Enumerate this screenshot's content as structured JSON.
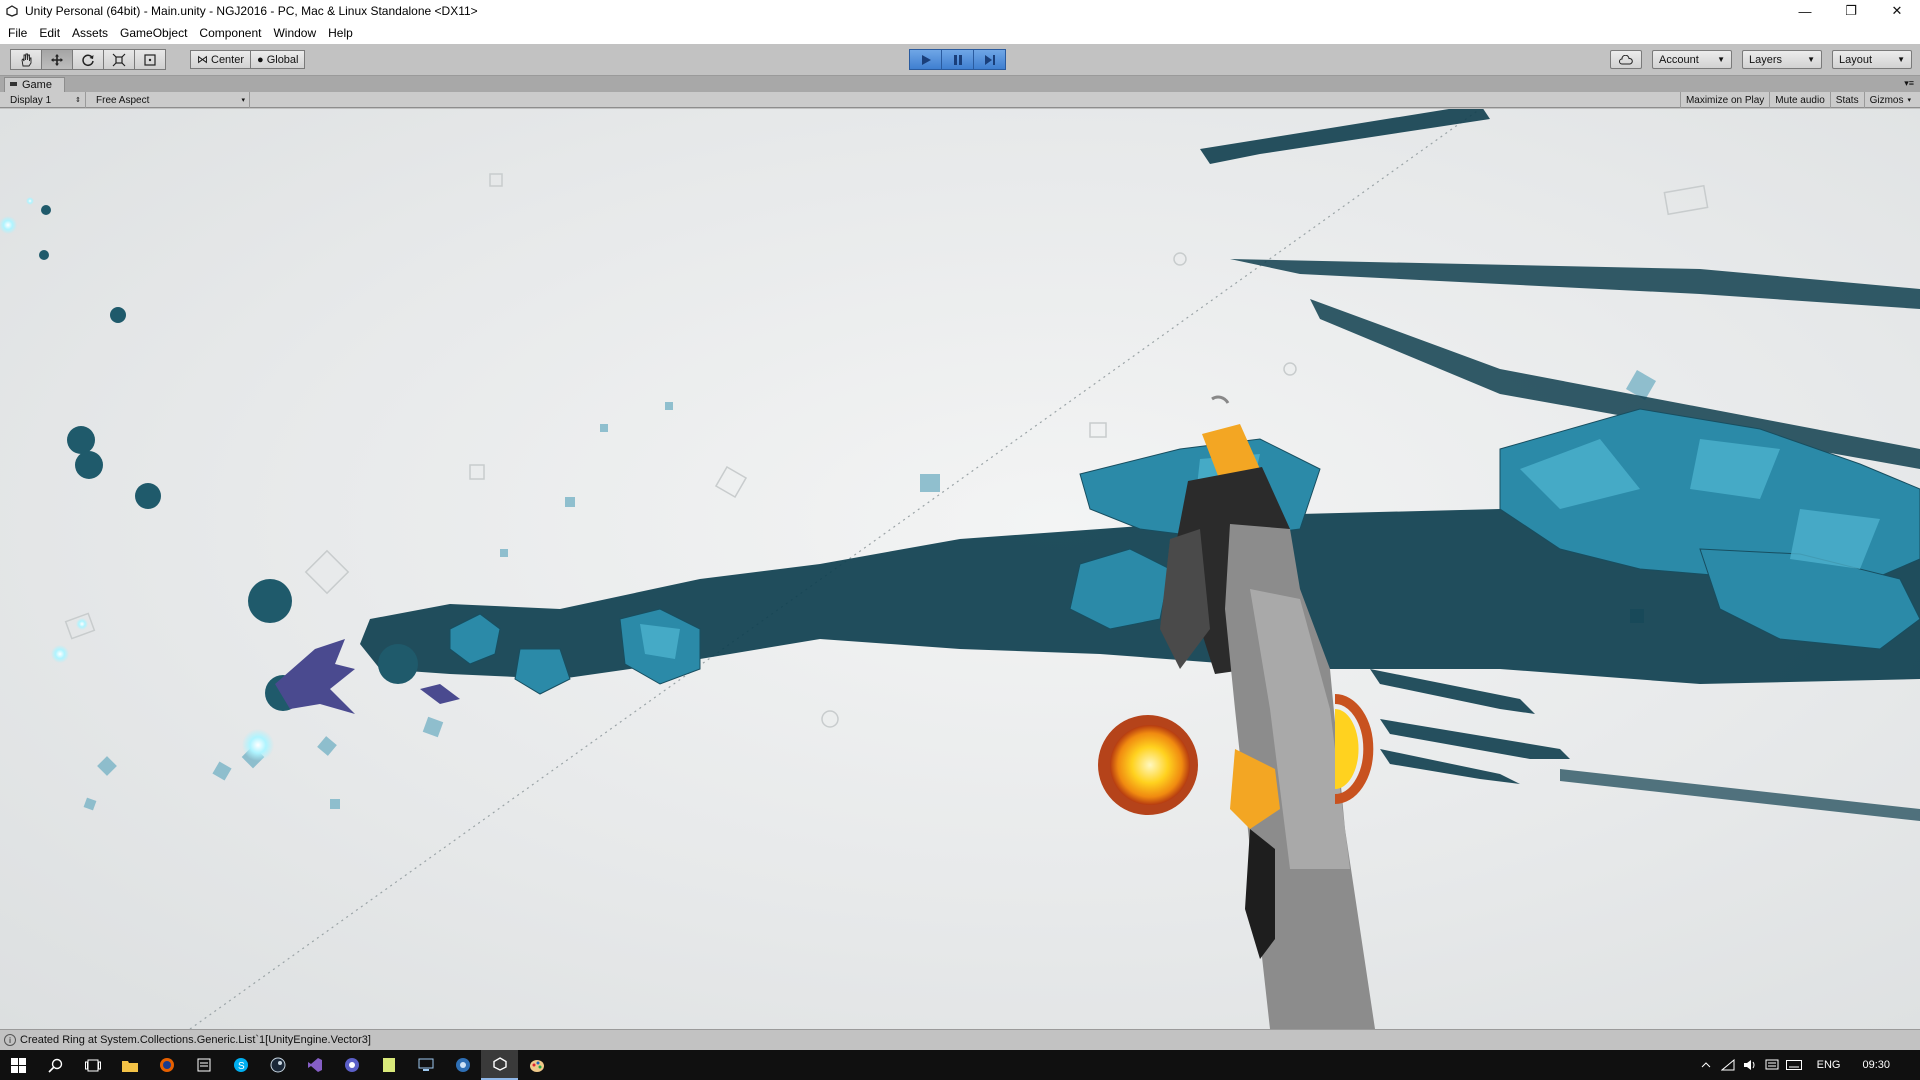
{
  "window": {
    "title": "Unity Personal (64bit) - Main.unity - NGJ2016 - PC, Mac & Linux Standalone <DX11>",
    "minimize": "—",
    "restore": "❐",
    "close": "✕"
  },
  "menu": {
    "items": [
      "File",
      "Edit",
      "Assets",
      "GameObject",
      "Component",
      "Window",
      "Help"
    ]
  },
  "toolbar": {
    "transform_tools": [
      "hand-icon",
      "move-icon",
      "rotate-icon",
      "scale-icon",
      "rect-tool-icon"
    ],
    "pivot_label": "Center",
    "space_label": "Global",
    "play_controls": [
      "play-icon",
      "pause-icon",
      "step-icon"
    ],
    "account_label": "Account",
    "layers_label": "Layers",
    "layout_label": "Layout"
  },
  "game_view": {
    "tab_label": "Game",
    "display_label": "Display 1",
    "aspect_label": "Free Aspect",
    "options": [
      "Maximize on Play",
      "Mute audio",
      "Stats",
      "Gizmos"
    ]
  },
  "status": {
    "message": "Created Ring at System.Collections.Generic.List`1[UnityEngine.Vector3]"
  },
  "taskbar": {
    "apps": [
      "windows-start-icon",
      "search-icon",
      "task-view-icon",
      "file-explorer-icon",
      "firefox-icon",
      "notes-icon",
      "skype-icon",
      "steam-icon",
      "visual-studio-icon",
      "browser-icon",
      "notepad-icon",
      "remote-desktop-icon",
      "app-icon",
      "unity-icon",
      "paint-icon"
    ],
    "language": "ENG",
    "time": "09:30"
  },
  "colors": {
    "play_accent": "#3f7fd0",
    "ink_trail": "#0e3f4f",
    "crystal": "#2f8fb0",
    "engine_glow": "#ffcc22"
  }
}
